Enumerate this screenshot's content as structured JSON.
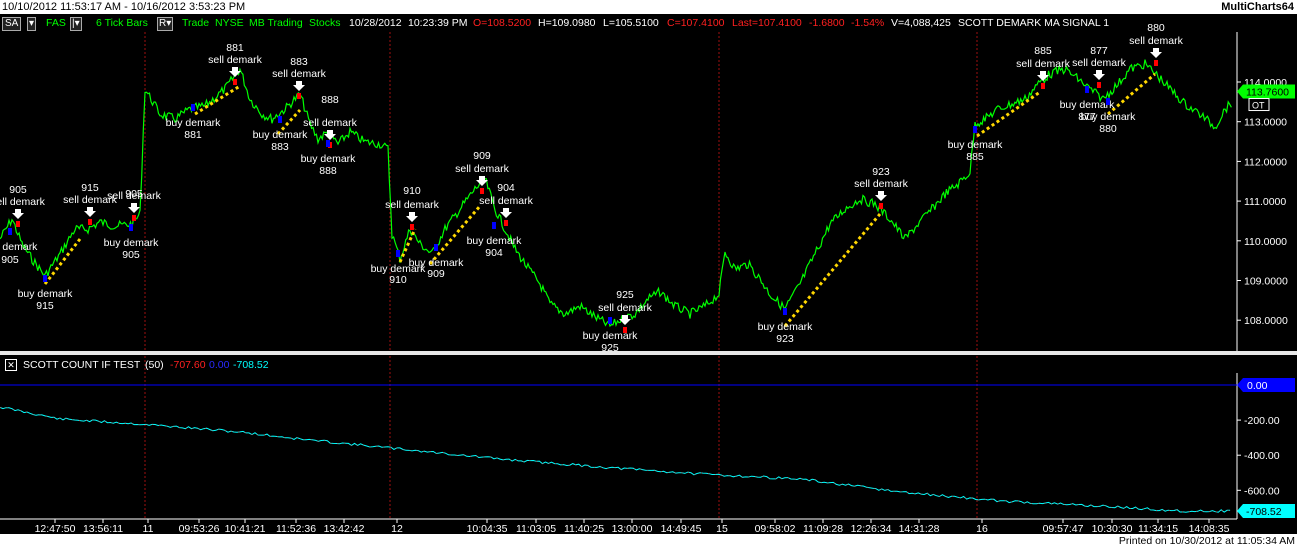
{
  "window": {
    "date_range": "10/10/2012 11:53:17 AM - 10/16/2012 3:53:23 PM",
    "brand": "MultiCharts64"
  },
  "header": {
    "mode_button": "SA",
    "symbol": "FAS",
    "interval_button": "|▾",
    "bar_type": "6 Tick Bars",
    "range_button": "R▾",
    "fields": [
      "Trade",
      "NYSE",
      "MB Trading",
      "Stocks"
    ],
    "date": "10/28/2012",
    "time": "10:23:39 PM",
    "open": "O=108.5200",
    "high": "H=109.0980",
    "low": "L=105.5100",
    "close": "C=107.4100",
    "last": "Last=107.4100",
    "change": "-1.6800",
    "change_pct": "-1.54%",
    "volume": "V=4,088,425",
    "study": "SCOTT DEMARK MA SIGNAL 1"
  },
  "colors": {
    "price_line": "#00ff00",
    "background": "#000000",
    "buy_marker": "#0000ff",
    "sell_marker": "#ff0000",
    "trend_line": "#ffd700",
    "indicator_line": "#00ffff",
    "zero_line": "#0000ff",
    "price_badge": "#00ff00",
    "indicator_badge": "#00ffff",
    "zero_badge": "#0000ff"
  },
  "price_axis": {
    "ticks": [
      "114.0000",
      "113.0000",
      "112.0000",
      "111.0000",
      "110.0000",
      "109.0000",
      "108.0000"
    ],
    "current_price": "113.7600",
    "ot_badge": "OT"
  },
  "signals": [
    {
      "label": "sell demark",
      "num": "905"
    },
    {
      "label": "buy demark",
      "num": "905"
    },
    {
      "label": "buy demark",
      "num": "915"
    },
    {
      "label": "sell demark",
      "num": "915"
    },
    {
      "label": "sell demark",
      "num": "905"
    },
    {
      "label": "buy demark",
      "num": "905"
    },
    {
      "label": "sell demark",
      "num": "881"
    },
    {
      "label": "buy demark",
      "num": "881"
    },
    {
      "label": "sell demark",
      "num": "883"
    },
    {
      "label": "buy demark",
      "num": "883"
    },
    {
      "label": "sell demark",
      "num": "888"
    },
    {
      "label": "buy demark",
      "num": "888"
    },
    {
      "label": "sell demark",
      "num": "910"
    },
    {
      "label": "buy demark",
      "num": "910"
    },
    {
      "label": "buy demark",
      "num": "909"
    },
    {
      "label": "sell demark",
      "num": "909"
    },
    {
      "label": "sell demark",
      "num": "904"
    },
    {
      "label": "buy demark",
      "num": "904"
    },
    {
      "label": "sell demark",
      "num": "925"
    },
    {
      "label": "buy demark",
      "num": "925"
    },
    {
      "label": "buy demark",
      "num": "923"
    },
    {
      "label": "sell demark",
      "num": "923"
    },
    {
      "label": "buy demark",
      "num": "885"
    },
    {
      "label": "sell demark",
      "num": "885"
    },
    {
      "label": "sell demark",
      "num": "877"
    },
    {
      "label": "buy demark",
      "num": "877"
    },
    {
      "label": "sell demark",
      "num": "880"
    },
    {
      "label": "buy demark",
      "num": "880"
    }
  ],
  "indicator": {
    "name": "SCOTT COUNT IF TEST",
    "param": "(50)",
    "value1": "-707.60",
    "value2": "0.00",
    "value3": "-708.52",
    "ticks": [
      "0.00",
      "-200.00",
      "-400.00",
      "-600.00"
    ],
    "last_badge": "-708.52"
  },
  "time_axis": {
    "labels": [
      "12:47:50",
      "13:56:11",
      "11",
      "09:53:26",
      "10:41:21",
      "11:52:36",
      "13:42:42",
      "12",
      "10:04:35",
      "11:03:05",
      "11:40:25",
      "13:00:00",
      "14:49:45",
      "15",
      "09:58:02",
      "11:09:28",
      "12:26:34",
      "14:31:28",
      "16",
      "09:57:47",
      "10:30:30",
      "11:34:15",
      "14:08:35"
    ]
  },
  "footer": {
    "printed": "Printed on 10/30/2012 at 11:05:34 AM"
  }
}
